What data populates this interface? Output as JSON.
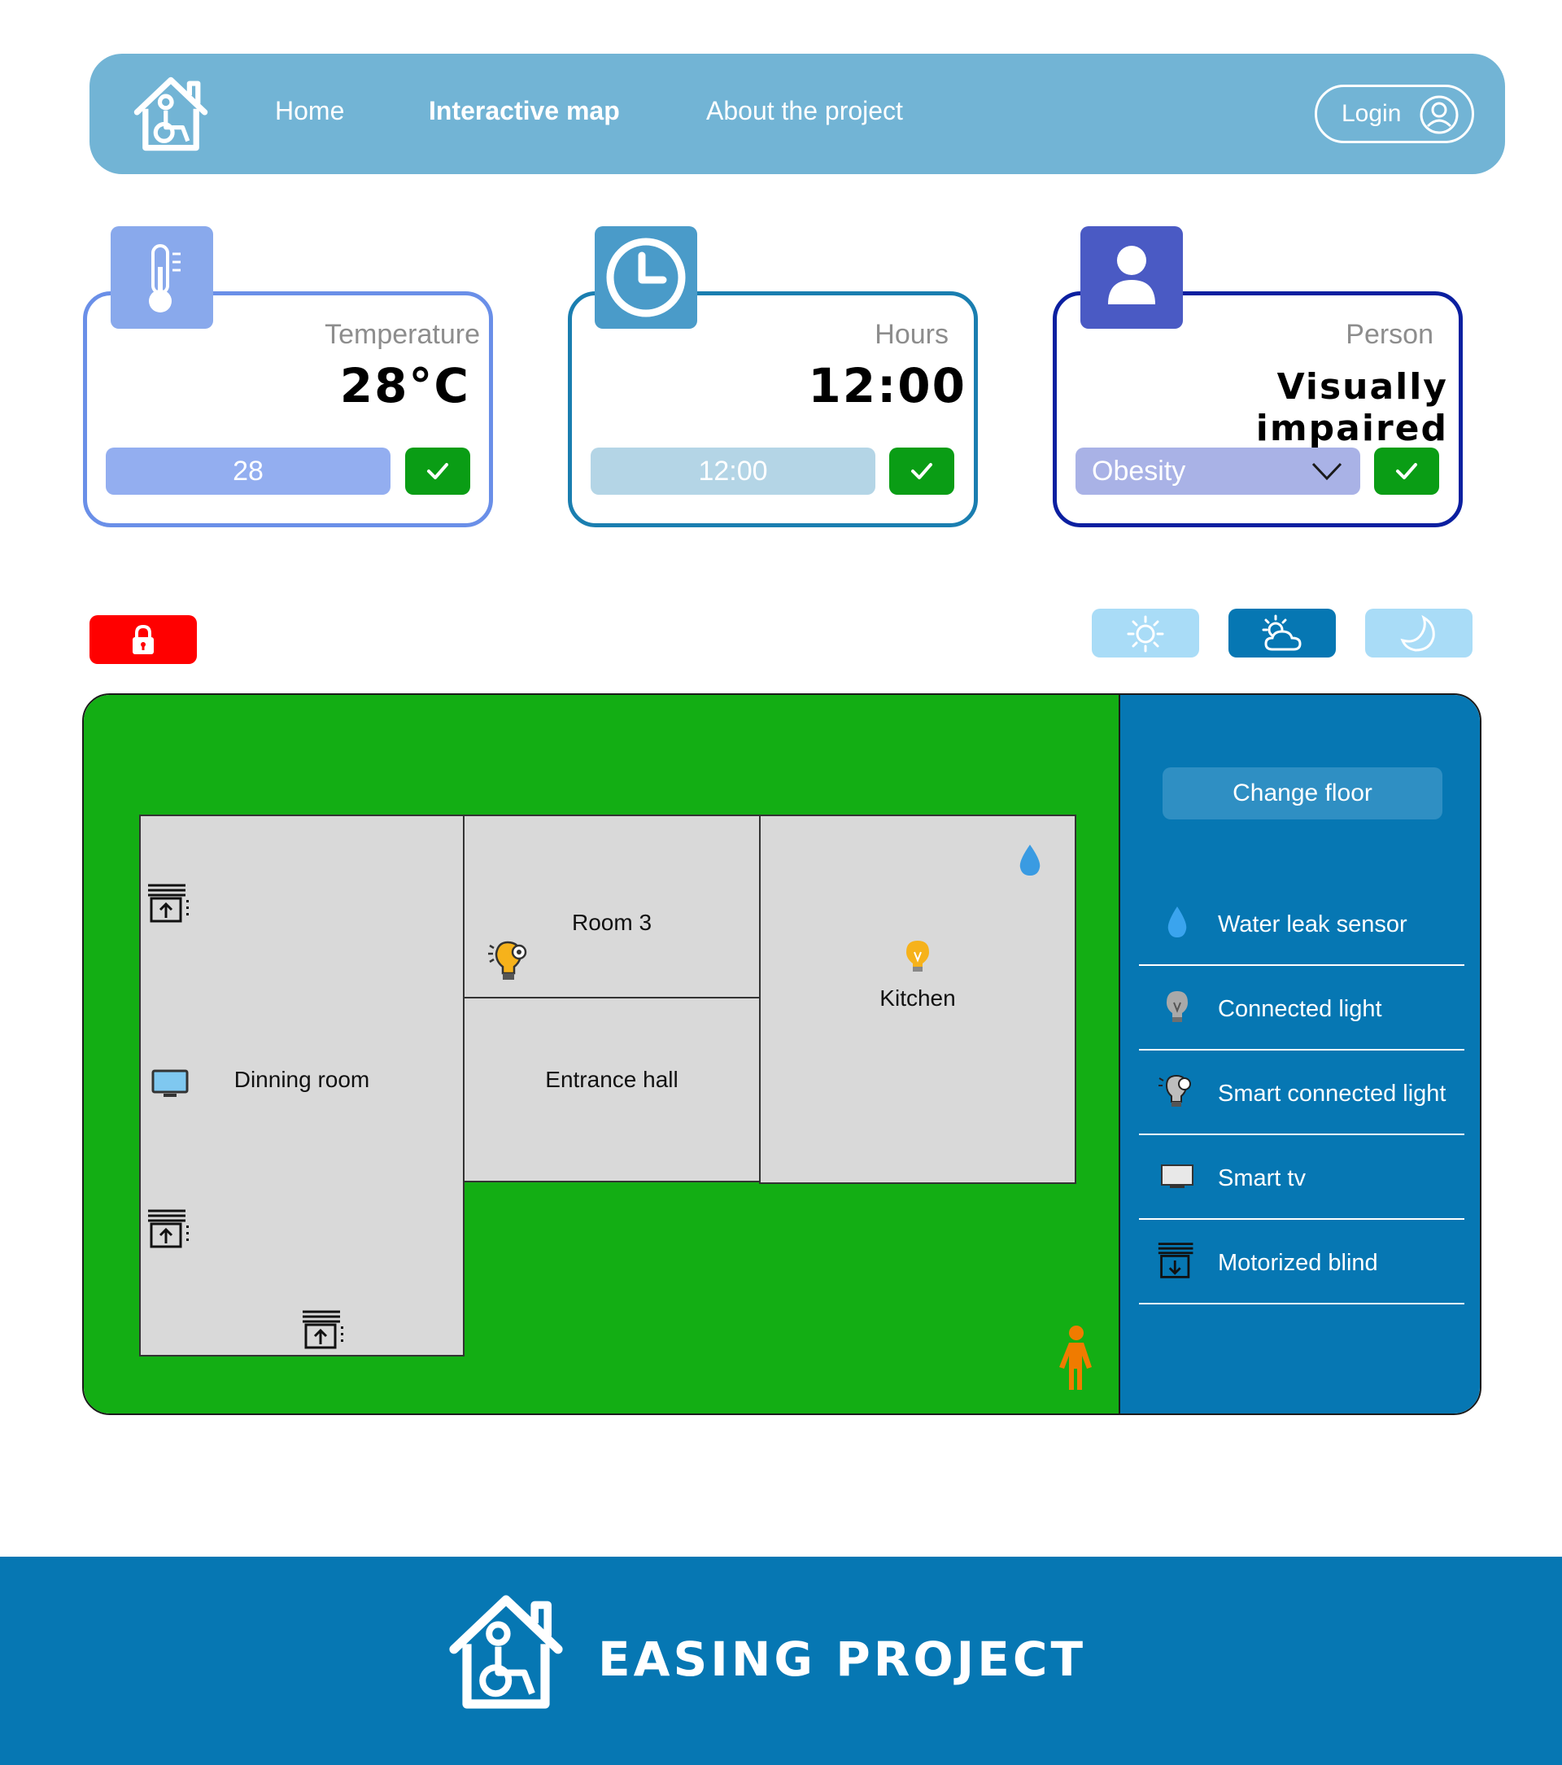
{
  "nav": {
    "links": [
      "Home",
      "Interactive map",
      "About the project"
    ],
    "login_label": "Login"
  },
  "cards": {
    "temperature": {
      "label": "Temperature",
      "value": "28°C",
      "input_value": "28",
      "color": "#6a8fe8"
    },
    "hours": {
      "label": "Hours",
      "value": "12:00",
      "input_value": "12:00",
      "color": "#1a7eb0"
    },
    "person": {
      "label": "Person",
      "value": "Visually impaired",
      "select_value": "Obesity",
      "color": "#0b1fa0"
    }
  },
  "controls": {
    "lock_icon": "lock-icon",
    "modes": [
      "sun-icon",
      "cloud-sun-icon",
      "moon-icon"
    ],
    "active_mode": "cloud-sun-icon"
  },
  "map": {
    "rooms": {
      "dining": "Dinning room",
      "room3": "Room 3",
      "entrance": "Entrance hall",
      "kitchen": "Kitchen"
    }
  },
  "sidebar": {
    "change_floor": "Change floor",
    "legend": [
      {
        "label": "Water leak sensor",
        "icon": "water-drop-icon"
      },
      {
        "label": "Connected light",
        "icon": "light-bulb-icon"
      },
      {
        "label": "Smart connected light",
        "icon": "smart-bulb-icon"
      },
      {
        "label": "Smart tv",
        "icon": "tv-icon"
      },
      {
        "label": "Motorized blind",
        "icon": "blind-icon"
      }
    ]
  },
  "footer": {
    "title": "EASING PROJECT"
  },
  "colors": {
    "navbar": "#72b4d5",
    "map_green": "#13ae14",
    "sidebar_blue": "#0677b3",
    "check_green": "#0a9d15",
    "lock_red": "#ff0000",
    "person_orange": "#f07b00"
  }
}
